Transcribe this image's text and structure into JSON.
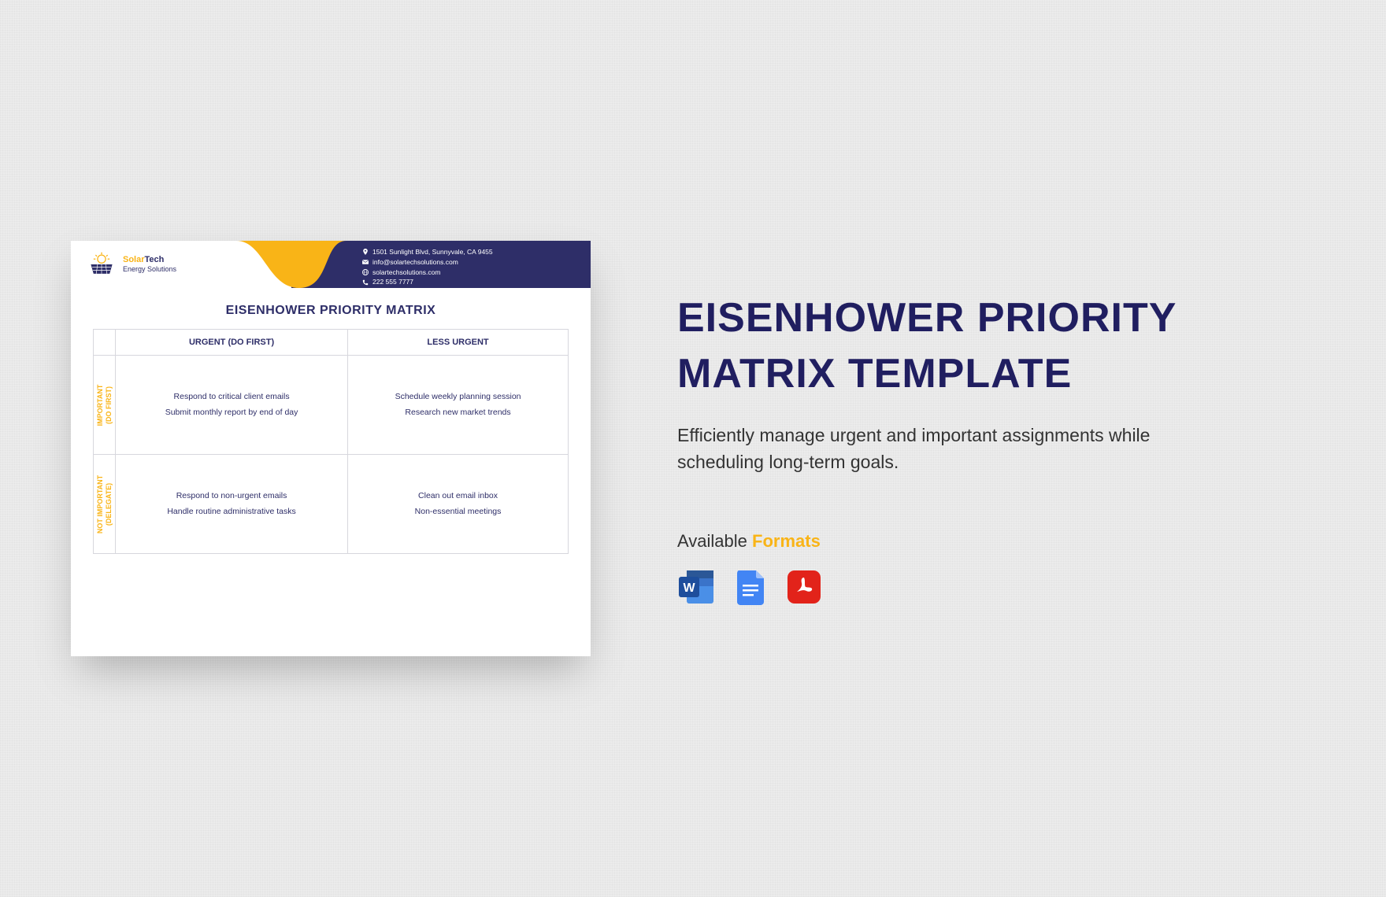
{
  "document": {
    "company": {
      "brand_a": "Solar",
      "brand_b": "Tech",
      "tagline": "Energy Solutions"
    },
    "contact": {
      "address": "1501 Sunlight Blvd, Sunnyvale, CA 9455",
      "email": "info@solartechsolutions.com",
      "web": "solartechsolutions.com",
      "phone": "222 555 7777"
    },
    "matrix_title": "EISENHOWER PRIORITY MATRIX",
    "columns": [
      "URGENT (DO FIRST)",
      "LESS URGENT"
    ],
    "rows": [
      {
        "label": "IMPORTANT\n(DO FIRST)",
        "cells": [
          [
            "Respond to critical client emails",
            "Submit monthly report by end of day"
          ],
          [
            "Schedule weekly planning session",
            "Research new market trends"
          ]
        ]
      },
      {
        "label": "NOT IMPORTANT\n(DELEGATE)",
        "cells": [
          [
            "Respond to non-urgent emails",
            "Handle routine administrative tasks"
          ],
          [
            "Clean out email inbox",
            "Non-essential meetings"
          ]
        ]
      }
    ]
  },
  "panel": {
    "title": "EISENHOWER PRIORITY MATRIX TEMPLATE",
    "description": "Efficiently manage urgent and important assignments while scheduling long-term goals.",
    "available_label": "Available",
    "formats_label": "Formats",
    "formats": [
      "word",
      "gdocs",
      "pdf"
    ]
  }
}
